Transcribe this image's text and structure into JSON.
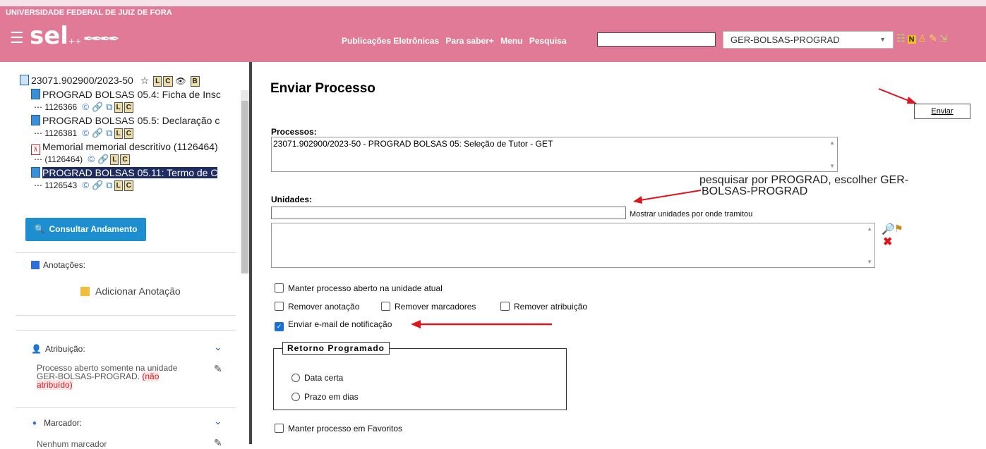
{
  "header": {
    "university": "UNIVERSIDADE FEDERAL DE JUIZ DE FORA",
    "logo": "sel",
    "logo_suffix": "++",
    "nav": [
      "Publicações Eletrônicas",
      "Para saber+",
      "Menu",
      "Pesquisa"
    ],
    "search_value": "",
    "unit_selected": "GER-BOLSAS-PROGRAD"
  },
  "tree": {
    "root": "23071.902900/2023-50",
    "nodes": [
      {
        "title": "PROGRAD BOLSAS 05.4: Ficha de Insc",
        "id": "1126366"
      },
      {
        "title": "PROGRAD BOLSAS 05.5: Declaração c",
        "id": "1126381"
      },
      {
        "title": "Memorial memorial descritivo (1126464)",
        "id": "(1126464)"
      },
      {
        "title": "PROGRAD BOLSAS 05.11: Termo de C",
        "id": "1126543"
      }
    ],
    "badges": {
      "l": "L",
      "c": "C",
      "b": "B"
    }
  },
  "left": {
    "consultar_button": "Consultar Andamento",
    "anotacoes_label": "Anotações:",
    "adicionar_anotacao": "Adicionar Anotação",
    "atribuicao_label": "Atribuição:",
    "atribuicao_text": "Processo aberto somente na unidade GER-BOLSAS-PROGRAD.",
    "atribuicao_flag": "(não atribuído)",
    "marcador_label": "Marcador:",
    "marcador_text": "Nenhum marcador"
  },
  "main": {
    "title": "Enviar Processo",
    "enviar_button": "Enviar",
    "processos_label": "Processos:",
    "processos_value": "23071.902900/2023-50 - PROGRAD BOLSAS 05: Seleção de Tutor - GET",
    "unidades_label": "Unidades:",
    "unidades_value": "",
    "mostrar_unidades": "Mostrar unidades por onde tramitou",
    "checkboxes": {
      "manter_aberto": "Manter processo aberto na unidade atual",
      "remover_anotacao": "Remover anotação",
      "remover_marcadores": "Remover marcadores",
      "remover_atribuicao": "Remover atribuição",
      "enviar_email": "Enviar e-mail de notificação",
      "manter_favoritos": "Manter processo em Favoritos"
    },
    "retorno_label": "Retorno Programado",
    "data_certa": "Data certa",
    "prazo_dias": "Prazo em dias",
    "annotation_line1": "pesquisar por PROGRAD, escolher GER-",
    "annotation_line2": "BOLSAS-PROGRAD"
  },
  "colors": {
    "header_bg": "#e17a97",
    "button_blue": "#1d8fd0",
    "arrow_red": "#e0141e",
    "selected_node": "#1e2c62"
  }
}
